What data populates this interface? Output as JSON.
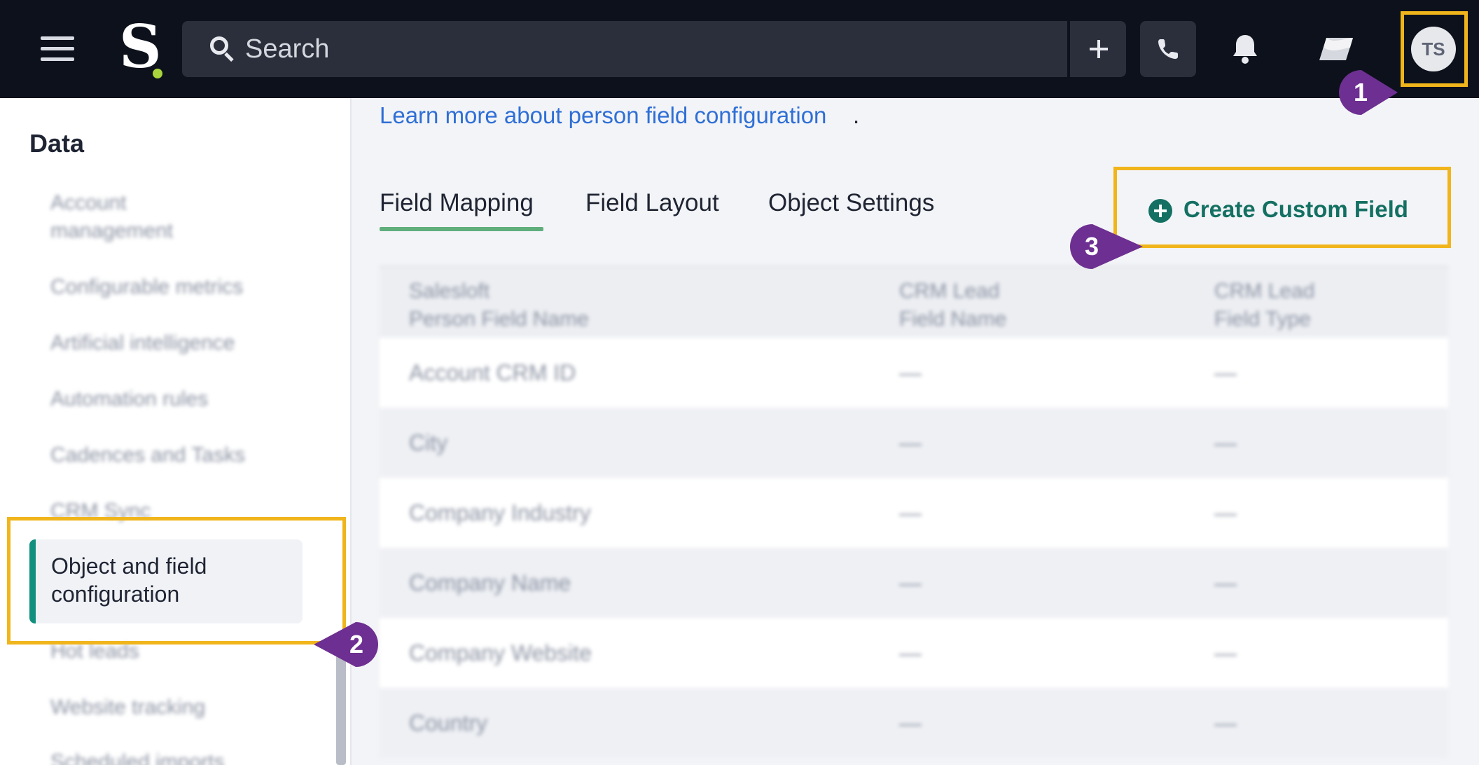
{
  "topbar": {
    "logo_letter": "S",
    "search_placeholder": "Search",
    "avatar_initials": "TS"
  },
  "sidebar": {
    "title": "Data",
    "items": [
      {
        "label": "Account management"
      },
      {
        "label": "Configurable metrics"
      },
      {
        "label": "Artificial intelligence"
      },
      {
        "label": "Automation rules"
      },
      {
        "label": "Cadences and Tasks"
      },
      {
        "label": "CRM Sync"
      },
      {
        "label": "Object and field configuration",
        "active": true
      },
      {
        "label": "Hot leads"
      },
      {
        "label": "Website tracking"
      },
      {
        "label": "Scheduled imports"
      }
    ]
  },
  "main": {
    "learn_link": "Learn more about person field configuration",
    "learn_suffix": ".",
    "tabs": [
      {
        "label": "Field Mapping",
        "active": true
      },
      {
        "label": "Field Layout"
      },
      {
        "label": "Object Settings"
      }
    ],
    "create_button": "Create Custom Field",
    "table": {
      "headers": [
        {
          "line1": "Salesloft",
          "line2": "Person Field Name"
        },
        {
          "line1": "CRM Lead",
          "line2": "Field Name"
        },
        {
          "line1": "CRM Lead",
          "line2": "Field Type"
        }
      ],
      "rows": [
        {
          "name": "Account CRM ID",
          "crm_name": "—",
          "crm_type": "—"
        },
        {
          "name": "City",
          "crm_name": "—",
          "crm_type": "—"
        },
        {
          "name": "Company Industry",
          "crm_name": "—",
          "crm_type": "—"
        },
        {
          "name": "Company Name",
          "crm_name": "—",
          "crm_type": "—"
        },
        {
          "name": "Company Website",
          "crm_name": "—",
          "crm_type": "—"
        },
        {
          "name": "Country",
          "crm_name": "—",
          "crm_type": "—"
        }
      ]
    }
  },
  "annotations": {
    "step1": "1",
    "step2": "2",
    "step3": "3"
  },
  "colors": {
    "accent_green": "#137062",
    "highlight": "#f1b51c",
    "badge_purple": "#6d2f91",
    "link_blue": "#2f6fd6"
  }
}
